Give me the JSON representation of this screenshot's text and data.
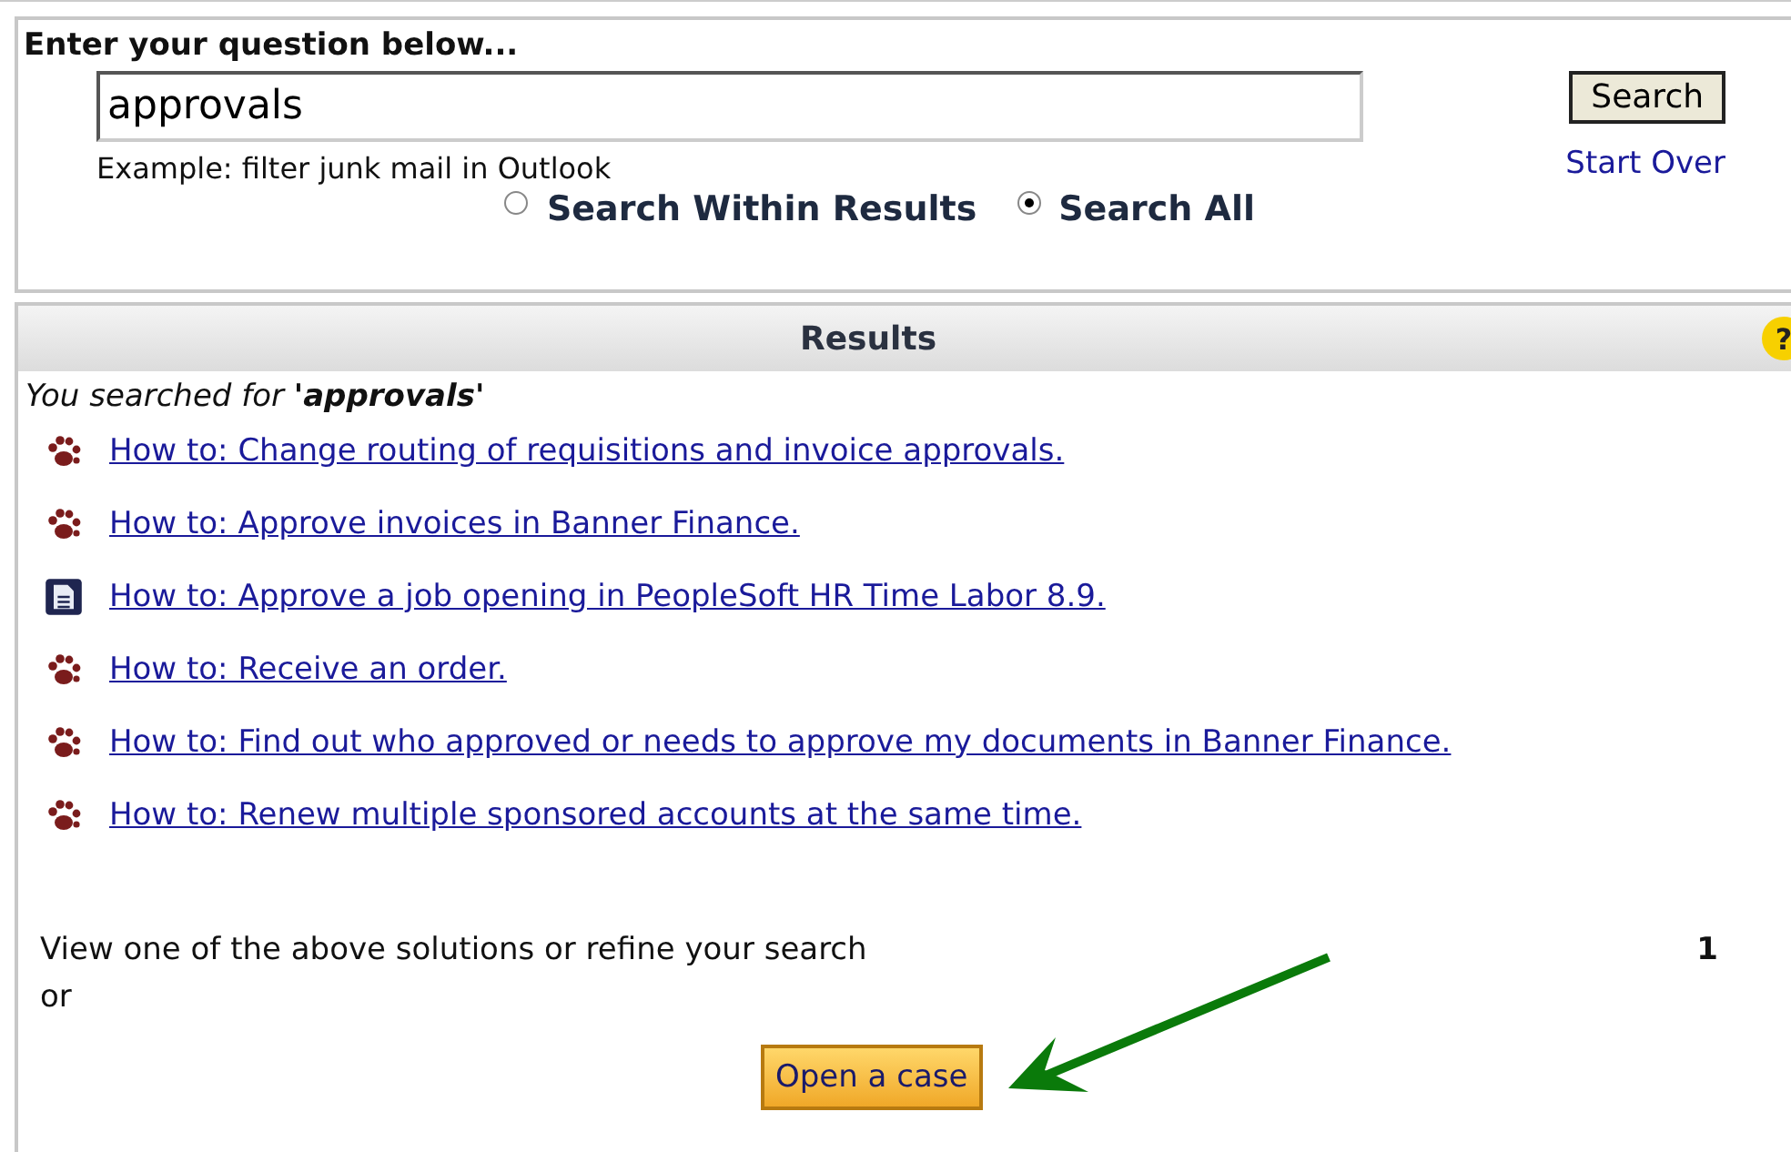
{
  "search_panel": {
    "heading": "Enter your question below...",
    "query": "approvals",
    "example": "Example: filter junk mail in Outlook",
    "search_button": "Search",
    "start_over": "Start Over",
    "scopes": [
      {
        "label": "Search Within Results",
        "selected": false
      },
      {
        "label": "Search All",
        "selected": true
      }
    ]
  },
  "results": {
    "title": "Results",
    "help": "?",
    "searched_prefix": "You searched for ",
    "searched_term": "'approvals'",
    "items": [
      {
        "kind": "paw",
        "title": "How to: Change routing of requisitions and invoice approvals."
      },
      {
        "kind": "paw",
        "title": "How to: Approve invoices in Banner Finance."
      },
      {
        "kind": "document",
        "title": "How to: Approve a job opening in PeopleSoft HR Time Labor 8.9."
      },
      {
        "kind": "paw",
        "title": "How to: Receive an order."
      },
      {
        "kind": "paw",
        "title": "How to: Find out who approved or needs to approve my documents in Banner Finance."
      },
      {
        "kind": "paw",
        "title": "How to: Renew multiple sponsored accounts at the same time."
      }
    ],
    "footer_text": "View one of the above solutions or refine your search",
    "footer_or": "or",
    "page_number": "1",
    "open_case_button": "Open a case"
  }
}
